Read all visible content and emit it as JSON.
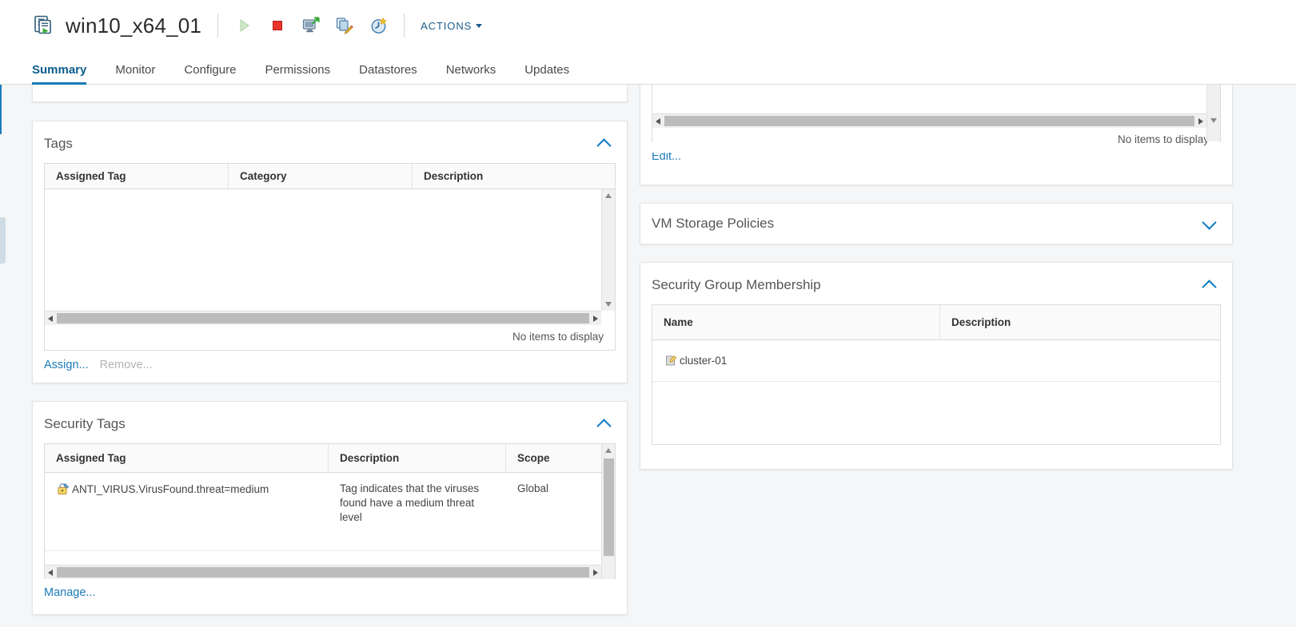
{
  "header": {
    "object_name": "win10_x64_01",
    "object_icon": "virtual-machine-powered-on-icon",
    "toolbar_icons": [
      {
        "name": "power-on-icon",
        "label": "Power On"
      },
      {
        "name": "power-off-icon",
        "label": "Power Off"
      },
      {
        "name": "launch-remote-console-icon",
        "label": "Launch Remote Console"
      },
      {
        "name": "edit-settings-icon",
        "label": "Edit Settings"
      },
      {
        "name": "snapshot-icon",
        "label": "Take Snapshot"
      }
    ],
    "actions_label": "ACTIONS"
  },
  "tabs": [
    {
      "label": "Summary",
      "active": true
    },
    {
      "label": "Monitor",
      "active": false
    },
    {
      "label": "Configure",
      "active": false
    },
    {
      "label": "Permissions",
      "active": false
    },
    {
      "label": "Datastores",
      "active": false
    },
    {
      "label": "Networks",
      "active": false
    },
    {
      "label": "Updates",
      "active": false
    }
  ],
  "left_column": {
    "tags_panel": {
      "title": "Tags",
      "collapsed": false,
      "chevron": "chevron-up-icon",
      "columns": [
        "Assigned Tag",
        "Category",
        "Description"
      ],
      "rows": [],
      "empty_text": "No items to display",
      "links": [
        {
          "label": "Assign...",
          "enabled": true
        },
        {
          "label": "Remove...",
          "enabled": false
        }
      ]
    },
    "security_tags_panel": {
      "title": "Security Tags",
      "collapsed": false,
      "chevron": "chevron-up-icon",
      "columns": [
        "Assigned Tag",
        "Description",
        "Scope"
      ],
      "rows": [
        {
          "icon": "security-tag-lock-icon",
          "assigned_tag": "ANTI_VIRUS.VirusFound.threat=medium",
          "description": "Tag indicates that the viruses found have a medium threat level",
          "scope": "Global"
        }
      ],
      "links": [
        {
          "label": "Manage...",
          "enabled": true
        }
      ]
    }
  },
  "right_column": {
    "top_panel": {
      "empty_text": "No items to display",
      "links": [
        {
          "label": "Edit...",
          "enabled": true
        }
      ]
    },
    "vm_storage_policies_panel": {
      "title": "VM Storage Policies",
      "collapsed": true,
      "chevron": "chevron-down-icon"
    },
    "security_group_membership_panel": {
      "title": "Security Group Membership",
      "collapsed": false,
      "chevron": "chevron-up-icon",
      "columns": [
        "Name",
        "Description"
      ],
      "rows": [
        {
          "icon": "security-group-icon",
          "name": "cluster-01",
          "description": ""
        }
      ]
    }
  },
  "colors": {
    "accent": "#1a7bb9",
    "link": "#1a7bb9",
    "page_bg": "#f5f6f7",
    "card_bg": "#ffffff",
    "tab_active": "#0b5c8c"
  }
}
